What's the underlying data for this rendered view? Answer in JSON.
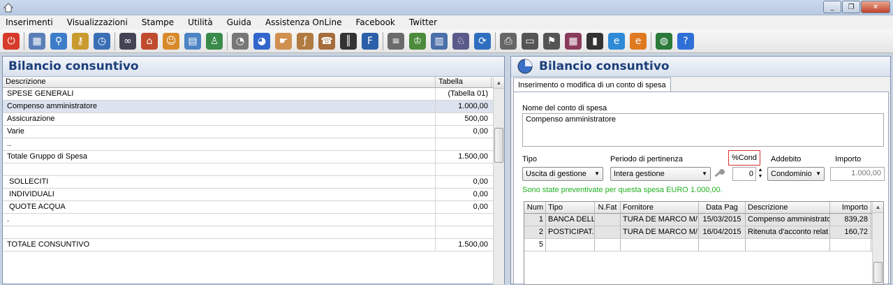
{
  "menu": [
    "Inserimenti",
    "Visualizzazioni",
    "Stampe",
    "Utilità",
    "Guida",
    "Assistenza OnLine",
    "Facebook",
    "Twitter"
  ],
  "toolbar_icons": [
    "power-icon",
    "calculator-icon",
    "magnifier-icon",
    "key-icon",
    "globe-clock-icon",
    "binoculars-icon",
    "house-icon",
    "people-icon",
    "grid-icon",
    "person-globe-icon",
    "pie-chart-icon",
    "pie-chart-blue-icon",
    "hand-icon",
    "fx-hand-icon",
    "phone-hand-icon",
    "barcode-icon",
    "f24-icon",
    "document-icon",
    "user-key-icon",
    "report-icon",
    "user-card-icon",
    "refresh-icon",
    "printer-icon",
    "scanner-icon",
    "stamp-icon",
    "folder-books-icon",
    "door-exit-icon",
    "globe-ie-icon",
    "em-icon",
    "earth-icon",
    "help-icon"
  ],
  "left": {
    "title": "Bilancio consuntivo",
    "columns": [
      "Descrizione",
      "Tabella"
    ],
    "rows": [
      {
        "d": "SPESE GENERALI",
        "t": "(Tabella 01)"
      },
      {
        "d": "Compenso amministratore",
        "t": "1.000,00"
      },
      {
        "d": "Assicurazione",
        "t": "500,00"
      },
      {
        "d": "Varie",
        "t": "0,00"
      },
      {
        "d": "..",
        "t": ""
      },
      {
        "d": "Totale Gruppo di Spesa",
        "t": "1.500,00"
      },
      {
        "d": "",
        "t": ""
      },
      {
        "d": " SOLLECITI",
        "t": "0,00"
      },
      {
        "d": " INDIVIDUALI",
        "t": "0,00"
      },
      {
        "d": " QUOTE ACQUA",
        "t": "0,00"
      },
      {
        "d": ".",
        "t": ""
      },
      {
        "d": "",
        "t": ""
      },
      {
        "d": "TOTALE CONSUNTIVO",
        "t": "1.500,00"
      }
    ]
  },
  "right": {
    "title": "Bilancio consuntivo",
    "tab": "Inserimento o modifica di un conto di spesa",
    "name_label": "Nome del conto di spesa",
    "name_value": "Compenso amministratore",
    "tipo_label": "Tipo",
    "periodo_label": "Periodo di pertinenza",
    "cond_label": "%Cond",
    "addebito_label": "Addebito",
    "importo_label": "Importo",
    "tipo_value": "Uscita di gestione",
    "periodo_value": "Intera gestione",
    "cond_value": "0",
    "addebito_value": "Condominio",
    "importo_value": "1.000,00",
    "note": "Sono state preventivate per questa spesa EURO 1.000,00.",
    "grid_columns": [
      "Num",
      "Tipo",
      "N.Fat",
      "Fornitore",
      "Data Pag",
      "Descrizione",
      "Importo"
    ],
    "grid_rows": [
      [
        "1",
        "BANCA DELL",
        "",
        "TURA DE MARCO M/",
        "15/03/2015",
        "Compenso amministrator",
        "839,28"
      ],
      [
        "2",
        "POSTICIPAT.",
        "",
        "TURA DE MARCO M/",
        "16/04/2015",
        "Ritenuta d'acconto relat",
        "160,72"
      ],
      [
        "5",
        "",
        "",
        "",
        "",
        "",
        ""
      ]
    ]
  },
  "colors": {
    "accent": "#1c3f7a",
    "note": "#20b020",
    "highlight": "#d93030"
  }
}
